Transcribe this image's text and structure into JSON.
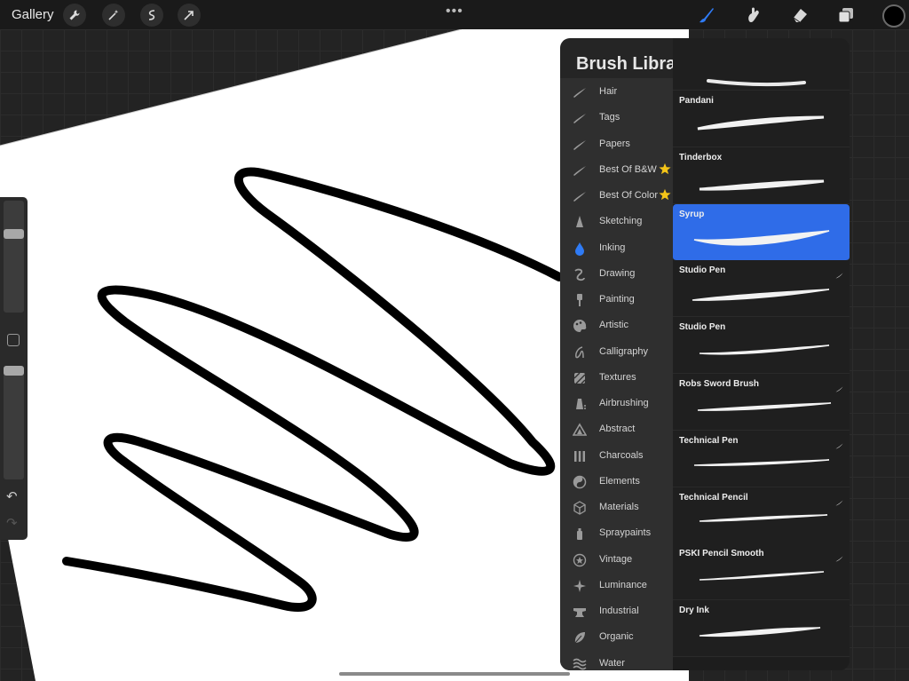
{
  "topbar": {
    "gallery_label": "Gallery",
    "more_label": "•••",
    "left_tools": [
      "wrench-icon",
      "magic-wand-icon",
      "selection-icon",
      "transform-arrow-icon"
    ],
    "right_tools": [
      "brush-icon",
      "smudge-icon",
      "eraser-icon",
      "layers-icon"
    ],
    "active_tool": "brush-icon",
    "current_color": "#000000"
  },
  "sidebar": {
    "size_level": 0.72,
    "opacity_level": 1.0,
    "undo_label": "↶",
    "redo_label": "↷"
  },
  "brush_library": {
    "title": "Brush Library",
    "add_label": "+",
    "categories": [
      {
        "label": "Hair",
        "icon": "brush-stroke-icon"
      },
      {
        "label": "Tags",
        "icon": "brush-stroke-icon"
      },
      {
        "label": "Papers",
        "icon": "brush-stroke-icon"
      },
      {
        "label": "Best Of B&W",
        "icon": "brush-stroke-icon",
        "starred": true
      },
      {
        "label": "Best Of Color",
        "icon": "brush-stroke-icon",
        "starred": true
      },
      {
        "label": "Sketching",
        "icon": "pencil-tip-icon"
      },
      {
        "label": "Inking",
        "icon": "ink-drop-icon",
        "active": true
      },
      {
        "label": "Drawing",
        "icon": "swirl-icon"
      },
      {
        "label": "Painting",
        "icon": "paint-brush-icon"
      },
      {
        "label": "Artistic",
        "icon": "palette-icon"
      },
      {
        "label": "Calligraphy",
        "icon": "calligraphy-icon"
      },
      {
        "label": "Textures",
        "icon": "texture-icon"
      },
      {
        "label": "Airbrushing",
        "icon": "airbrush-icon"
      },
      {
        "label": "Abstract",
        "icon": "triangle-icon"
      },
      {
        "label": "Charcoals",
        "icon": "charcoal-icon"
      },
      {
        "label": "Elements",
        "icon": "yin-yang-icon"
      },
      {
        "label": "Materials",
        "icon": "cube-icon"
      },
      {
        "label": "Spraypaints",
        "icon": "spray-can-icon"
      },
      {
        "label": "Vintage",
        "icon": "star-badge-icon"
      },
      {
        "label": "Luminance",
        "icon": "sparkle-icon"
      },
      {
        "label": "Industrial",
        "icon": "anvil-icon"
      },
      {
        "label": "Organic",
        "icon": "leaf-icon"
      },
      {
        "label": "Water",
        "icon": "waves-icon"
      }
    ],
    "brushes": [
      {
        "name": "Pandani",
        "imported": false,
        "selected": false
      },
      {
        "name": "Tinderbox",
        "imported": false,
        "selected": false
      },
      {
        "name": "Syrup",
        "imported": false,
        "selected": true
      },
      {
        "name": "Studio Pen",
        "imported": true,
        "selected": false
      },
      {
        "name": "Studio Pen",
        "imported": false,
        "selected": false
      },
      {
        "name": "Robs Sword Brush",
        "imported": true,
        "selected": false
      },
      {
        "name": "Technical Pen",
        "imported": true,
        "selected": false
      },
      {
        "name": "Technical Pencil",
        "imported": true,
        "selected": false
      },
      {
        "name": "PSKI Pencil Smooth",
        "imported": true,
        "selected": false
      },
      {
        "name": "Dry Ink",
        "imported": false,
        "selected": false
      }
    ]
  },
  "colors": {
    "accent": "#2f6ce8",
    "active_category": "#2f7bf5",
    "star": "#f5c518"
  }
}
